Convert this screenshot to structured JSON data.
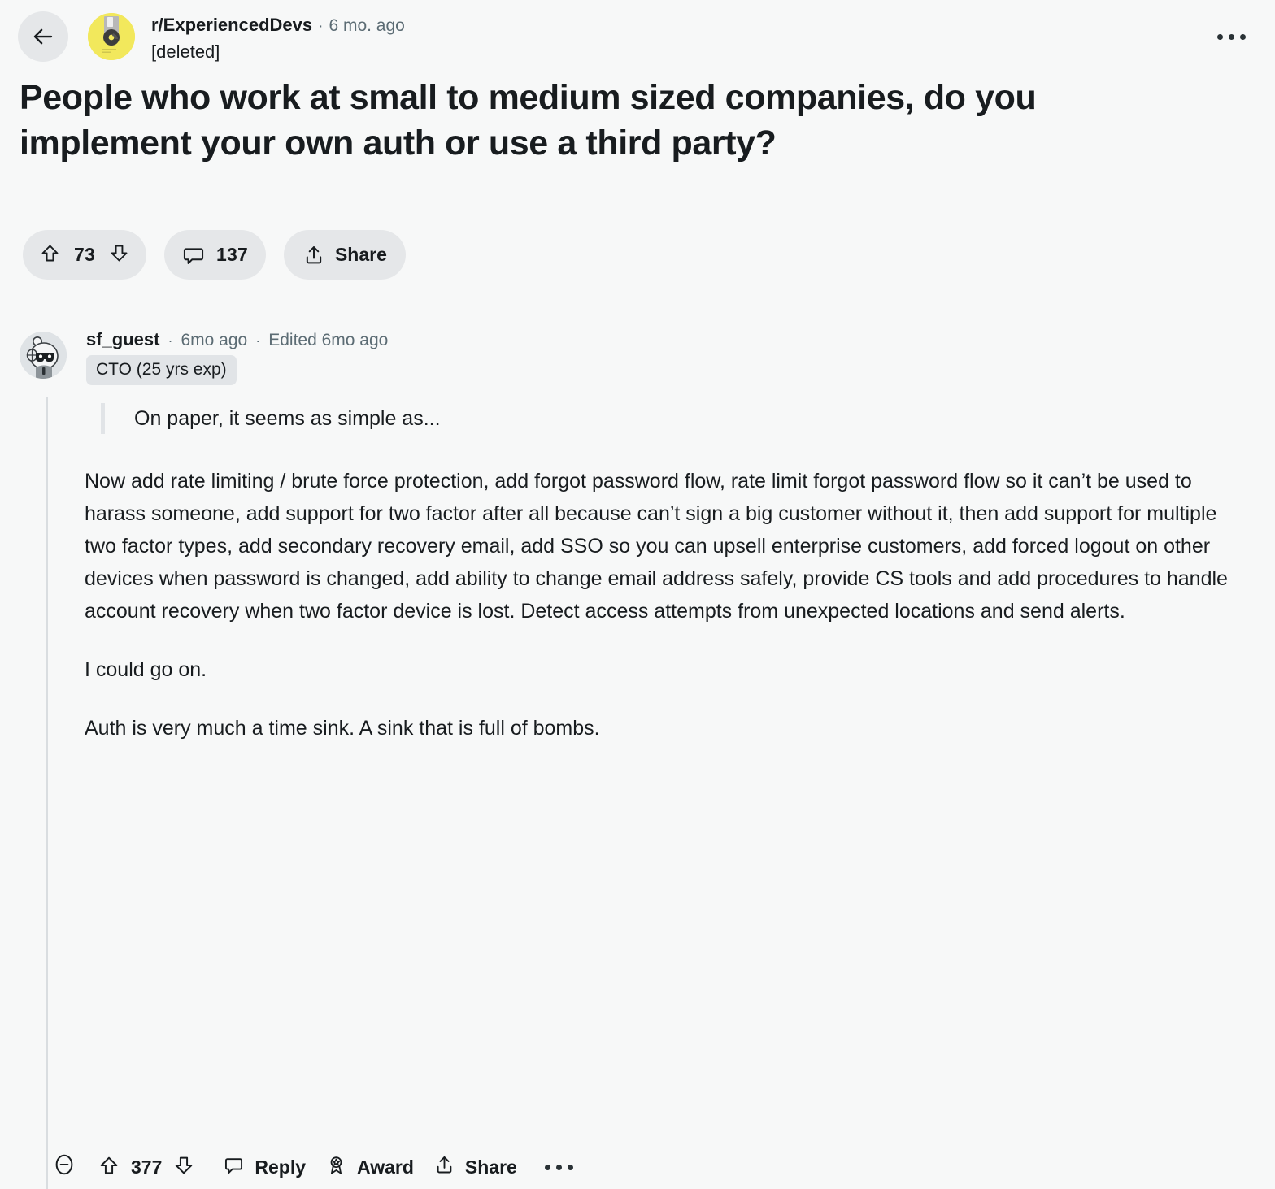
{
  "nav": {
    "back_label": "Back",
    "overflow_label": "More options"
  },
  "post": {
    "subreddit": "r/ExperiencedDevs",
    "separator": "·",
    "age": "6 mo. ago",
    "author": "[deleted]",
    "title": "People who work at small to medium sized companies, do you implement your own auth or use a third party?",
    "subreddit_avatar_icon": "floppy-disk-icon",
    "actions": {
      "upvote_icon": "upvote-arrow-icon",
      "score": "73",
      "downvote_icon": "downvote-arrow-icon",
      "comment_icon": "comment-bubble-icon",
      "comment_count": "137",
      "share_icon": "share-icon",
      "share_label": "Share"
    }
  },
  "comment": {
    "author": "sf_guest",
    "sep1": "·",
    "age": "6mo ago",
    "sep2": "·",
    "edited": "Edited 6mo ago",
    "flair": "CTO (25 yrs exp)",
    "avatar_icon": "snoo-avatar-icon",
    "quote": "On paper, it seems as simple as...",
    "paragraphs": [
      "Now add rate limiting / brute force protection, add forgot password flow, rate limit forgot password flow so it can’t be used to harass someone, add support for two factor after all because can’t sign a big customer without it, then add support for multiple two factor types, add secondary recovery email, add SSO so you can upsell enterprise customers, add forced logout on other devices when password is changed, add ability to change email address safely, provide CS tools and add procedures to handle account recovery when two factor device is lost. Detect access attempts from unexpected locations and send alerts.",
      "I could go on.",
      "Auth is very much a time sink. A sink that is full of bombs."
    ],
    "actions": {
      "collapse_icon": "collapse-minus-circle-icon",
      "upvote_icon": "upvote-arrow-icon",
      "score": "377",
      "downvote_icon": "downvote-arrow-icon",
      "reply_icon": "comment-bubble-icon",
      "reply_label": "Reply",
      "award_icon": "award-medal-icon",
      "award_label": "Award",
      "share_icon": "share-icon",
      "share_label": "Share",
      "overflow_icon": "more-horizontal-icon"
    }
  },
  "colors": {
    "page_background": "#f7f8f8",
    "pill_background": "#e5e7e9",
    "text_primary": "#181c1f",
    "text_muted": "#5c6c74",
    "thread_line": "#d9dde0",
    "avatar_yellow": "#f2e85c"
  }
}
